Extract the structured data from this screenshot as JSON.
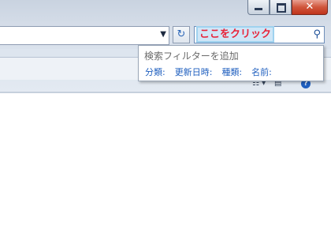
{
  "window": {
    "minimize_icon": "minimize-icon",
    "maximize_icon": "maximize-icon",
    "close_label": "✕"
  },
  "address_bar": {
    "dropdown_icon": "chevron-down-icon"
  },
  "refresh": {
    "icon": "refresh-icon",
    "glyph": "↻"
  },
  "search": {
    "value": "ここをクリック",
    "icon": "search-icon",
    "glyph": "⚲"
  },
  "search_popup": {
    "title": "検索フィルターを追加",
    "filters": [
      "分類:",
      "更新日時:",
      "種類:",
      "名前:"
    ]
  },
  "view": {
    "help_label": "?"
  },
  "colors": {
    "highlight_text": "#e8243a",
    "filter_link": "#1f5fbf"
  }
}
